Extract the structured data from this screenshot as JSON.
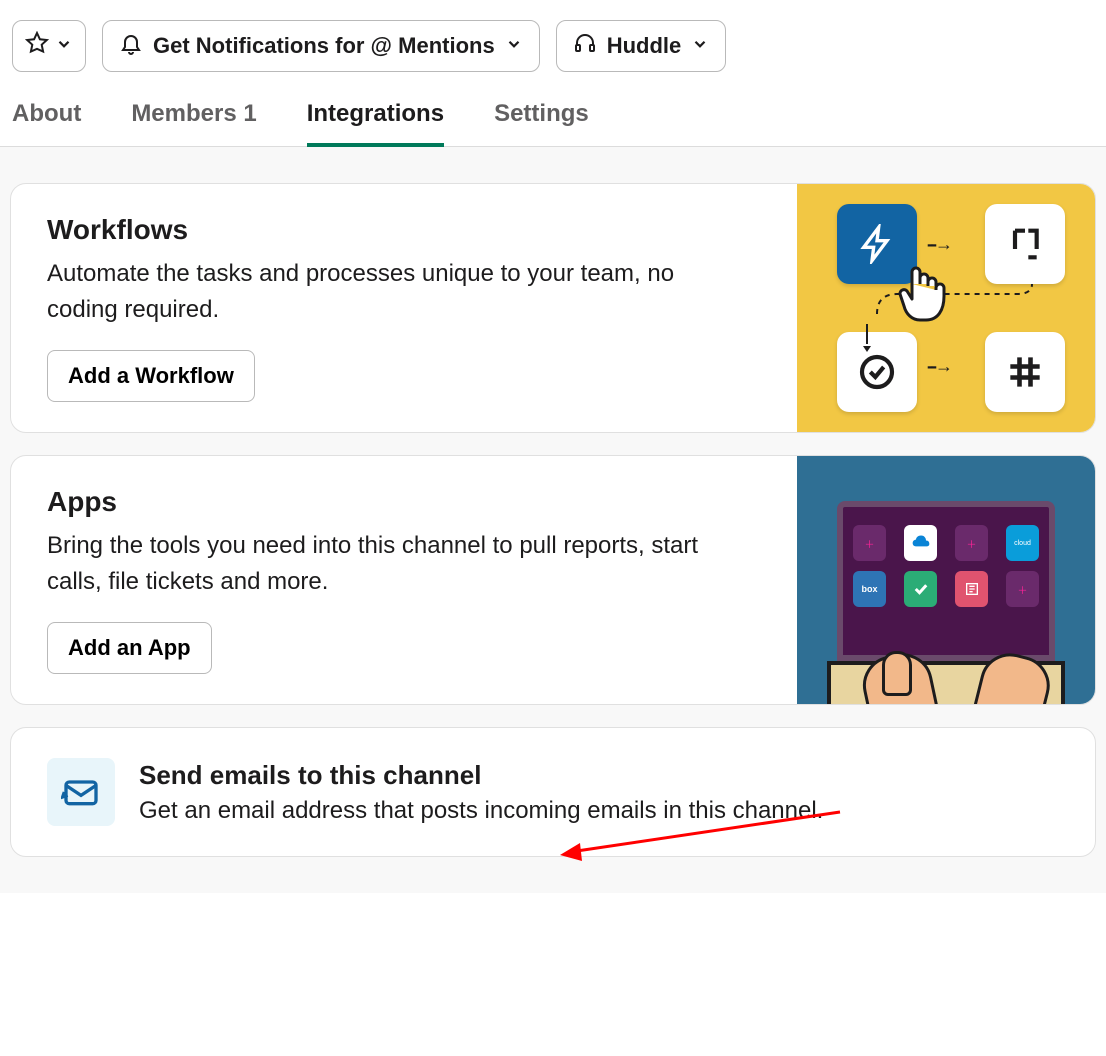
{
  "toolbar": {
    "notifications_label": "Get Notifications for @ Mentions",
    "huddle_label": "Huddle"
  },
  "tabs": {
    "about": "About",
    "members_label": "Members",
    "members_count": "1",
    "integrations": "Integrations",
    "settings": "Settings",
    "active": "integrations"
  },
  "workflows": {
    "title": "Workflows",
    "description": "Automate the tasks and processes unique to your team, no coding required.",
    "button": "Add a Workflow"
  },
  "apps": {
    "title": "Apps",
    "description": "Bring the tools you need into this channel to pull reports, start calls, file tickets and more.",
    "button": "Add an App"
  },
  "email": {
    "title": "Send emails to this channel",
    "description": "Get an email address that posts incoming emails in this channel."
  },
  "colors": {
    "accent": "#007a5a",
    "workflow_bg": "#f2c744",
    "apps_bg": "#2f6f94",
    "email_icon_bg": "#e8f5fa",
    "arrow_annotation": "#ff0000"
  }
}
